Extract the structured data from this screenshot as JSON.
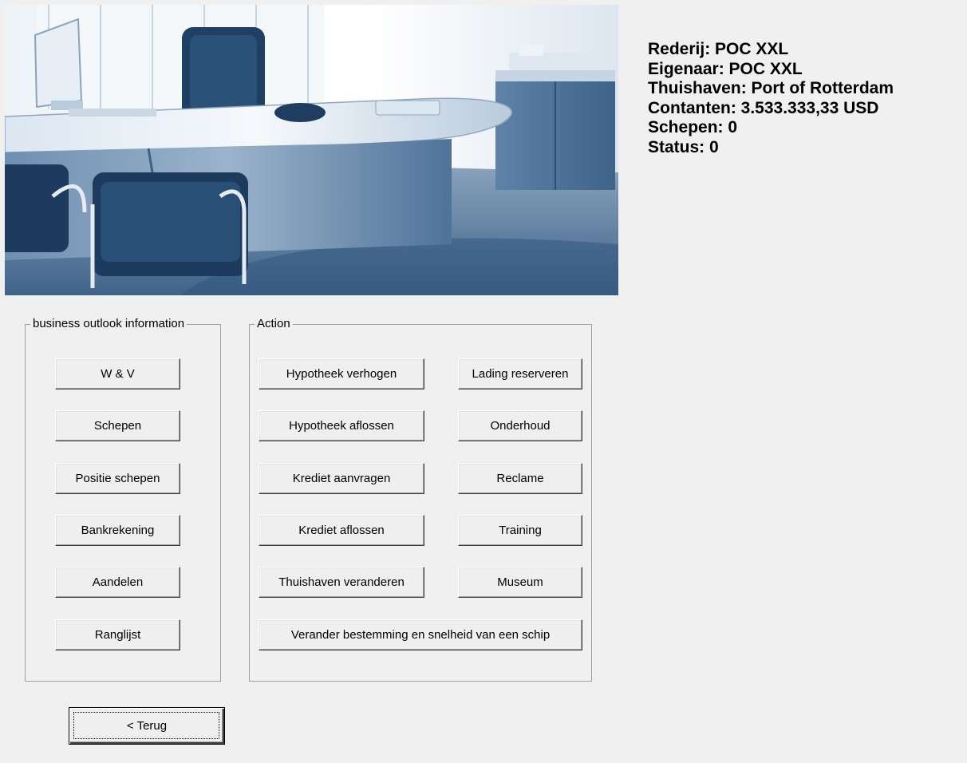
{
  "info": {
    "rederij": "Rederij: POC XXL",
    "eigenaar": "Eigenaar: POC XXL",
    "thuishaven": "Thuishaven: Port of Rotterdam",
    "contanten": "Contanten: 3.533.333,33 USD",
    "schepen": "Schepen:  0",
    "status": "Status:  0"
  },
  "outlook": {
    "title": "business outlook information",
    "buttons": [
      {
        "label": "W & V"
      },
      {
        "label": "Schepen"
      },
      {
        "label": "Positie schepen"
      },
      {
        "label": "Bankrekening"
      },
      {
        "label": "Aandelen"
      },
      {
        "label": "Ranglijst"
      }
    ]
  },
  "action": {
    "title": "Action",
    "buttons": [
      {
        "label": "Hypotheek verhogen"
      },
      {
        "label": "Lading reserveren"
      },
      {
        "label": "Hypotheek aflossen"
      },
      {
        "label": "Onderhoud"
      },
      {
        "label": "Krediet aanvragen"
      },
      {
        "label": "Reclame"
      },
      {
        "label": "Krediet aflossen"
      },
      {
        "label": "Training"
      },
      {
        "label": "Thuishaven veranderen"
      },
      {
        "label": "Museum"
      },
      {
        "label": "Verander bestemming en snelheid van een schip"
      }
    ]
  },
  "back_button": {
    "label": "< Terug"
  }
}
